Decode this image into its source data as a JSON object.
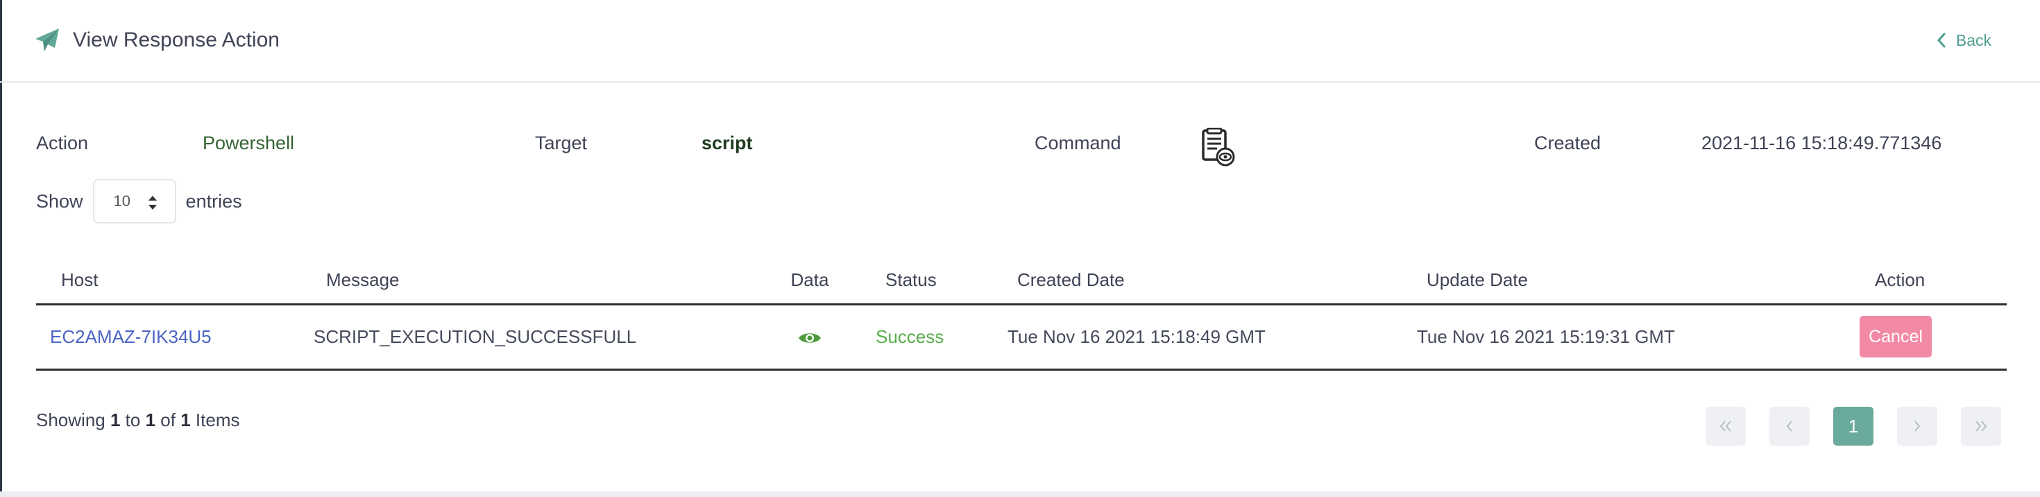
{
  "header": {
    "title": "View Response Action",
    "back_label": "Back",
    "icon": "paper-plane-icon"
  },
  "info": {
    "action_label": "Action",
    "action_value": "Powershell",
    "target_label": "Target",
    "target_value": "script",
    "command_label": "Command",
    "command_icon": "script-view-icon",
    "created_label": "Created",
    "created_value": "2021-11-16 15:18:49.771346"
  },
  "length": {
    "show_label": "Show",
    "value": "10",
    "entries_label": "entries"
  },
  "table": {
    "columns": [
      "Host",
      "Message",
      "Data",
      "Status",
      "Created Date",
      "Update Date",
      "Action"
    ],
    "rows": [
      {
        "host": "EC2AMAZ-7IK34U5",
        "message": "SCRIPT_EXECUTION_SUCCESSFULL",
        "data_icon": "eye-icon",
        "status": "Success",
        "created": "Tue Nov 16 2021 15:18:49 GMT",
        "updated": "Tue Nov 16 2021 15:19:31 GMT",
        "action": "Cancel"
      }
    ]
  },
  "footer": {
    "showing_prefix": "Showing",
    "from": "1",
    "to_word": "to",
    "to": "1",
    "of_word": "of",
    "total": "1",
    "items_word": "Items"
  },
  "pagination": {
    "current_page": "1"
  },
  "colors": {
    "accent": "#6aaa9c",
    "link": "#4a63c4",
    "success": "#5aad4d",
    "cancel": "#f28aa6"
  }
}
